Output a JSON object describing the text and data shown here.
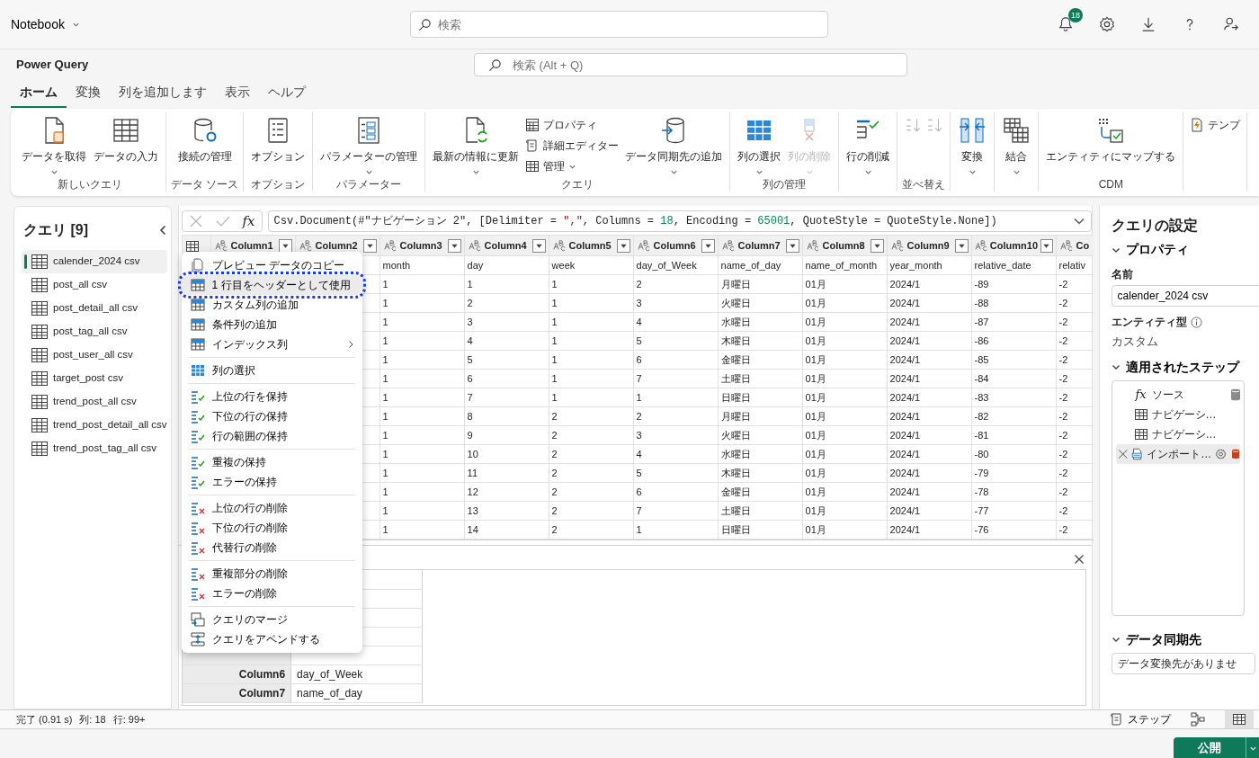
{
  "app": {
    "title": "Notebook",
    "search_placeholder": "検索",
    "notifications": "18"
  },
  "window": {
    "title": "Power Query",
    "search_placeholder": "検索 (Alt + Q)"
  },
  "tabs": [
    {
      "label": "ホーム",
      "selected": true
    },
    {
      "label": "変換",
      "selected": false
    },
    {
      "label": "列を追加します",
      "selected": false
    },
    {
      "label": "表示",
      "selected": false
    },
    {
      "label": "ヘルプ",
      "selected": false
    }
  ],
  "ribbon": {
    "groups": [
      {
        "label": "新しいクエリ",
        "buttons": [
          {
            "kind": "large",
            "label": "データを取得",
            "dropdown": true,
            "disabled": false
          },
          {
            "kind": "large",
            "label": "データの入力",
            "dropdown": false,
            "disabled": false
          }
        ]
      },
      {
        "label": "データ ソース",
        "buttons": [
          {
            "kind": "large",
            "label": "接続の管理",
            "dropdown": false,
            "disabled": false
          }
        ]
      },
      {
        "label": "オプション",
        "buttons": [
          {
            "kind": "large",
            "label": "オプション",
            "dropdown": false,
            "disabled": false
          }
        ]
      },
      {
        "label": "パラメーター",
        "buttons": [
          {
            "kind": "large",
            "label": "パラメーターの管理",
            "dropdown": true,
            "disabled": false
          }
        ]
      },
      {
        "label": "クエリ",
        "buttons": [
          {
            "kind": "large",
            "label": "最新の情報に更新",
            "dropdown": true,
            "disabled": false
          },
          {
            "kind": "small",
            "label": "プロパティ",
            "dropdown": false,
            "disabled": false
          },
          {
            "kind": "small",
            "label": "詳細エディター",
            "dropdown": false,
            "disabled": false
          },
          {
            "kind": "small",
            "label": "管理",
            "dropdown": true,
            "disabled": false
          },
          {
            "kind": "large",
            "label": "データ同期先の追加",
            "dropdown": true,
            "disabled": false
          }
        ]
      },
      {
        "label": "列の管理",
        "buttons": [
          {
            "kind": "large",
            "label": "列の選択",
            "dropdown": true,
            "disabled": false
          },
          {
            "kind": "large",
            "label": "列の削除",
            "dropdown": true,
            "disabled": true
          }
        ]
      },
      {
        "buttons": [
          {
            "kind": "large",
            "label": "行の削減",
            "dropdown": true,
            "disabled": false
          }
        ]
      },
      {
        "label": "並べ替え",
        "buttons": [
          {
            "kind": "icon",
            "dropdown": false,
            "disabled": true
          },
          {
            "kind": "icon",
            "dropdown": false,
            "disabled": true
          }
        ]
      },
      {
        "buttons": [
          {
            "kind": "large",
            "label": "変換",
            "dropdown": true,
            "disabled": false
          }
        ]
      },
      {
        "buttons": [
          {
            "kind": "large",
            "label": "結合",
            "dropdown": true,
            "disabled": false
          }
        ]
      },
      {
        "label": "CDM",
        "buttons": [
          {
            "kind": "large",
            "label": "エンティティにマップする",
            "dropdown": false,
            "disabled": false
          }
        ]
      },
      {
        "buttons": [
          {
            "kind": "small",
            "label": "テンプ",
            "dropdown": false,
            "disabled": false
          }
        ]
      }
    ]
  },
  "queries": {
    "title": "クエリ [9]",
    "items": [
      {
        "label": "calender_2024 csv",
        "selected": true
      },
      {
        "label": "post_all csv",
        "selected": false
      },
      {
        "label": "post_detail_all csv",
        "selected": false
      },
      {
        "label": "post_tag_all csv",
        "selected": false
      },
      {
        "label": "post_user_all csv",
        "selected": false
      },
      {
        "label": "target_post csv",
        "selected": false
      },
      {
        "label": "trend_post_all csv",
        "selected": false
      },
      {
        "label": "trend_post_detail_all csv",
        "selected": false
      },
      {
        "label": "trend_post_tag_all csv",
        "selected": false
      }
    ]
  },
  "formula_bar": {
    "fx": "fx",
    "tokens": [
      {
        "kind": "code",
        "text": "Csv.Document(#\"ナビゲーション 2\", [Delimiter = "
      },
      {
        "kind": "string",
        "text": "\",\""
      },
      {
        "kind": "code",
        "text": ", Columns = "
      },
      {
        "kind": "number",
        "text": "18"
      },
      {
        "kind": "code",
        "text": ", Encoding = "
      },
      {
        "kind": "number",
        "text": "65001"
      },
      {
        "kind": "code",
        "text": ", QuoteStyle = QuoteStyle.None])"
      }
    ]
  },
  "grid": {
    "columns": [
      "Column1",
      "Column2",
      "Column3",
      "Column4",
      "Column5",
      "Column6",
      "Column7",
      "Column8",
      "Column9",
      "Column10",
      "Co"
    ],
    "rows": [
      [
        "",
        "",
        "month",
        "day",
        "week",
        "day_of_Week",
        "name_of_day",
        "name_of_month",
        "year_month",
        "relative_date",
        "relativ"
      ],
      [
        "",
        "",
        "1",
        "1",
        "1",
        "2",
        "月曜日",
        "01月",
        "2024/1",
        "-89",
        "-2"
      ],
      [
        "",
        "",
        "1",
        "2",
        "1",
        "3",
        "火曜日",
        "01月",
        "2024/1",
        "-88",
        "-2"
      ],
      [
        "",
        "",
        "1",
        "3",
        "1",
        "4",
        "水曜日",
        "01月",
        "2024/1",
        "-87",
        "-2"
      ],
      [
        "",
        "",
        "1",
        "4",
        "1",
        "5",
        "木曜日",
        "01月",
        "2024/1",
        "-86",
        "-2"
      ],
      [
        "",
        "",
        "1",
        "5",
        "1",
        "6",
        "金曜日",
        "01月",
        "2024/1",
        "-85",
        "-2"
      ],
      [
        "",
        "",
        "1",
        "6",
        "1",
        "7",
        "土曜日",
        "01月",
        "2024/1",
        "-84",
        "-2"
      ],
      [
        "",
        "",
        "1",
        "7",
        "1",
        "1",
        "日曜日",
        "01月",
        "2024/1",
        "-83",
        "-2"
      ],
      [
        "",
        "",
        "1",
        "8",
        "2",
        "2",
        "月曜日",
        "01月",
        "2024/1",
        "-82",
        "-2"
      ],
      [
        "",
        "",
        "1",
        "9",
        "2",
        "3",
        "火曜日",
        "01月",
        "2024/1",
        "-81",
        "-2"
      ],
      [
        "",
        "",
        "1",
        "10",
        "2",
        "4",
        "水曜日",
        "01月",
        "2024/1",
        "-80",
        "-2"
      ],
      [
        "",
        "",
        "1",
        "11",
        "2",
        "5",
        "木曜日",
        "01月",
        "2024/1",
        "-79",
        "-2"
      ],
      [
        "",
        "",
        "1",
        "12",
        "2",
        "6",
        "金曜日",
        "01月",
        "2024/1",
        "-78",
        "-2"
      ],
      [
        "",
        "",
        "1",
        "13",
        "2",
        "7",
        "土曜日",
        "01月",
        "2024/1",
        "-77",
        "-2"
      ],
      [
        "",
        "",
        "1",
        "14",
        "2",
        "1",
        "日曜日",
        "01月",
        "2024/1",
        "-76",
        "-2"
      ]
    ]
  },
  "context_menu": {
    "groups": [
      {
        "items": [
          {
            "label": "プレビュー データのコピー",
            "selected": false,
            "annotated": false,
            "submenu": false
          },
          {
            "label": "1 行目をヘッダーとして使用",
            "selected": true,
            "annotated": true,
            "submenu": false
          },
          {
            "label": "カスタム列の追加",
            "selected": false,
            "annotated": false,
            "submenu": false
          },
          {
            "label": "条件列の追加",
            "selected": false,
            "annotated": false,
            "submenu": false
          },
          {
            "label": "インデックス列",
            "selected": false,
            "annotated": false,
            "submenu": true
          }
        ]
      },
      {
        "items": [
          {
            "label": "列の選択",
            "selected": false,
            "annotated": false,
            "submenu": false
          }
        ]
      },
      {
        "items": [
          {
            "label": "上位の行を保持",
            "selected": false,
            "annotated": false,
            "submenu": false
          },
          {
            "label": "下位の行の保持",
            "selected": false,
            "annotated": false,
            "submenu": false
          },
          {
            "label": "行の範囲の保持",
            "selected": false,
            "annotated": false,
            "submenu": false
          }
        ]
      },
      {
        "items": [
          {
            "label": "重複の保持",
            "selected": false,
            "annotated": false,
            "submenu": false
          },
          {
            "label": "エラーの保持",
            "selected": false,
            "annotated": false,
            "submenu": false
          }
        ]
      },
      {
        "items": [
          {
            "label": "上位の行の削除",
            "selected": false,
            "annotated": false,
            "submenu": false
          },
          {
            "label": "下位の行の削除",
            "selected": false,
            "annotated": false,
            "submenu": false
          },
          {
            "label": "代替行の削除",
            "selected": false,
            "annotated": false,
            "submenu": false
          }
        ]
      },
      {
        "items": [
          {
            "label": "重複部分の削除",
            "selected": false,
            "annotated": false,
            "submenu": false
          },
          {
            "label": "エラーの削除",
            "selected": false,
            "annotated": false,
            "submenu": false
          }
        ]
      },
      {
        "items": [
          {
            "label": "クエリのマージ",
            "selected": false,
            "annotated": false,
            "submenu": false
          },
          {
            "label": "クエリをアペンドする",
            "selected": false,
            "annotated": false,
            "submenu": false
          }
        ]
      }
    ]
  },
  "profile": {
    "rows": [
      {
        "name": "Column6",
        "value": "day_of_Week"
      },
      {
        "name": "Column7",
        "value": "name_of_day"
      }
    ]
  },
  "settings": {
    "title": "クエリの設定",
    "properties": {
      "label": "プロパティ",
      "expanded": true,
      "name_label": "名前",
      "name_value": "calender_2024 csv",
      "entity_label": "エンティティ型",
      "entity_value": "カスタム"
    },
    "steps_section": {
      "label": "適用されたステップ",
      "expanded": true,
      "steps": [
        {
          "kind": "formula",
          "icon_text": "fx",
          "label": "ソース",
          "selected": false,
          "color": "#8a8a8a"
        },
        {
          "kind": "table",
          "label": "ナビゲーシ…",
          "selected": false
        },
        {
          "kind": "table",
          "label": "ナビゲーシ…",
          "selected": false
        },
        {
          "kind": "csv",
          "label": "インポート…",
          "selected": true,
          "color": "#c4421a"
        }
      ]
    },
    "destination": {
      "label": "データ同期先",
      "expanded": true,
      "value": "データ変換先がありませ"
    }
  },
  "status": {
    "text": "完了 (0.91 s)",
    "columns": "列: 18",
    "rows": "行: 99+",
    "steps_button": "ステップ",
    "views": [
      {
        "selected": false
      },
      {
        "selected": true
      }
    ]
  },
  "publish": {
    "label": "公開"
  }
}
